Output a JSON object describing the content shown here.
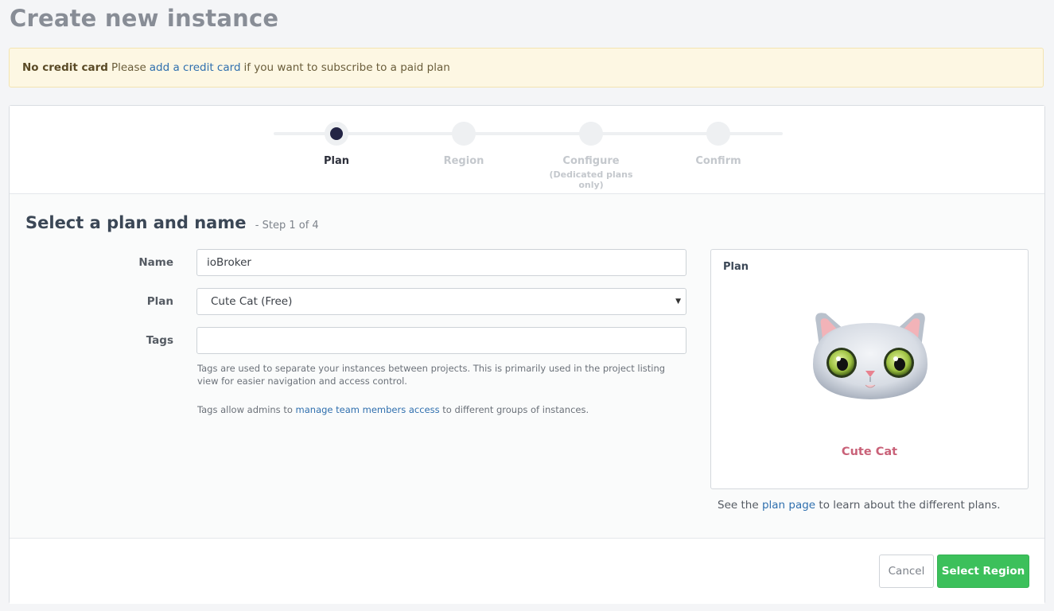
{
  "page": {
    "title": "Create new instance"
  },
  "alert": {
    "strong": "No credit card",
    "text_before": "Please",
    "link": "add a credit card",
    "text_after": "if you want to subscribe to a paid plan"
  },
  "steps": [
    {
      "label": "Plan",
      "sub": ""
    },
    {
      "label": "Region",
      "sub": ""
    },
    {
      "label": "Configure",
      "sub": "(Dedicated plans only)"
    },
    {
      "label": "Confirm",
      "sub": ""
    }
  ],
  "form": {
    "section_title": "Select a plan and name",
    "step_note": "- Step 1 of 4",
    "name_label": "Name",
    "name_value": "ioBroker",
    "plan_label": "Plan",
    "plan_value": "Cute Cat (Free)",
    "tags_label": "Tags",
    "tags_value": "",
    "help1": "Tags are used to separate your instances between projects. This is primarily used in the project listing view for easier navigation and access control.",
    "help2_before": "Tags allow admins to",
    "help2_link": "manage team members access",
    "help2_after": "to different groups of instances."
  },
  "plan_panel": {
    "title": "Plan",
    "name": "Cute Cat",
    "footer_before": "See the",
    "footer_link": "plan page",
    "footer_after": "to learn about the different plans."
  },
  "buttons": {
    "cancel": "Cancel",
    "next": "Select Region"
  },
  "colors": {
    "accent_green": "#3cc05b",
    "link_blue": "#2f6fae",
    "plan_name": "#c96178",
    "step_active": "#232445"
  }
}
